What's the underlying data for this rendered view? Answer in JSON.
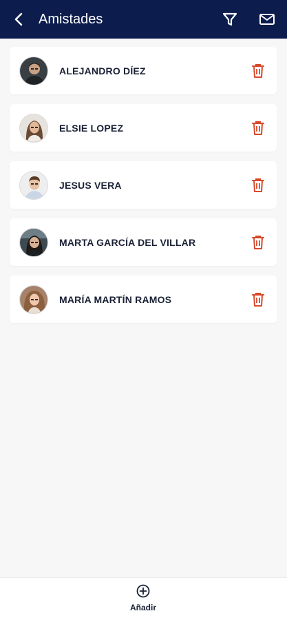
{
  "header": {
    "title": "Amistades",
    "background_color": "#0b1c4d",
    "back_icon": "chevron-left-icon",
    "filter_icon": "filter-icon",
    "mail_icon": "mail-icon"
  },
  "friends": [
    {
      "name": "ALEJANDRO DÍEZ",
      "avatar_icon": "avatar-photo"
    },
    {
      "name": "ELSIE LOPEZ",
      "avatar_icon": "avatar-photo"
    },
    {
      "name": "JESUS VERA",
      "avatar_icon": "avatar-photo"
    },
    {
      "name": "MARTA GARCÍA DEL VILLAR",
      "avatar_icon": "avatar-photo"
    },
    {
      "name": "MARÍA MARTÍN RAMOS",
      "avatar_icon": "avatar-photo"
    }
  ],
  "delete_icon": "trash-icon",
  "delete_color": "#d9482b",
  "bottom_bar": {
    "add_label": "Añadir",
    "add_icon": "plus-circle-icon"
  }
}
